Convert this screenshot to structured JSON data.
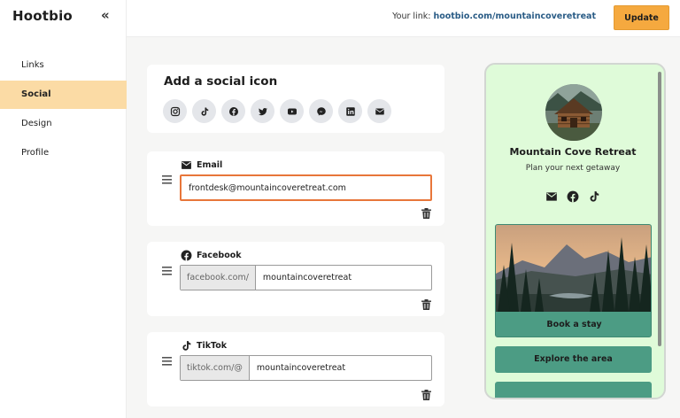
{
  "app": {
    "name": "Hootbio",
    "collapse_glyph": "«"
  },
  "sidebar": {
    "items": [
      {
        "label": "Links",
        "active": false
      },
      {
        "label": "Social",
        "active": true
      },
      {
        "label": "Design",
        "active": false
      },
      {
        "label": "Profile",
        "active": false
      }
    ]
  },
  "topbar": {
    "link_label": "Your link:",
    "link_url": "hootbio.com/mountaincoveretreat",
    "update_label": "Update"
  },
  "add_social": {
    "title": "Add a social icon",
    "icons": [
      "instagram-icon",
      "tiktok-icon",
      "facebook-icon",
      "twitter-icon",
      "youtube-icon",
      "messenger-icon",
      "linkedin-icon",
      "email-icon"
    ]
  },
  "socials": [
    {
      "label": "Email",
      "icon": "email-icon",
      "prefix": "",
      "value": "frontdesk@mountaincoveretreat.com"
    },
    {
      "label": "Facebook",
      "icon": "facebook-icon",
      "prefix": "facebook.com/",
      "value": "mountaincoveretreat"
    },
    {
      "label": "TikTok",
      "icon": "tiktok-icon",
      "prefix": "tiktok.com/@",
      "value": "mountaincoveretreat"
    }
  ],
  "preview": {
    "name": "Mountain Cove Retreat",
    "tagline": "Plan your next getaway",
    "social_icons": [
      "email-icon",
      "facebook-icon",
      "tiktok-icon"
    ],
    "links": [
      {
        "label": "Book a stay",
        "has_image": true
      },
      {
        "label": "Explore the area",
        "has_image": false
      }
    ]
  },
  "colors": {
    "accent": "#f5a93f",
    "active_nav": "#fbdba5",
    "link_text": "#2a5c86",
    "focus_border": "#e8763a",
    "preview_bg": "#dffbd9",
    "preview_button": "#4c9c84"
  }
}
